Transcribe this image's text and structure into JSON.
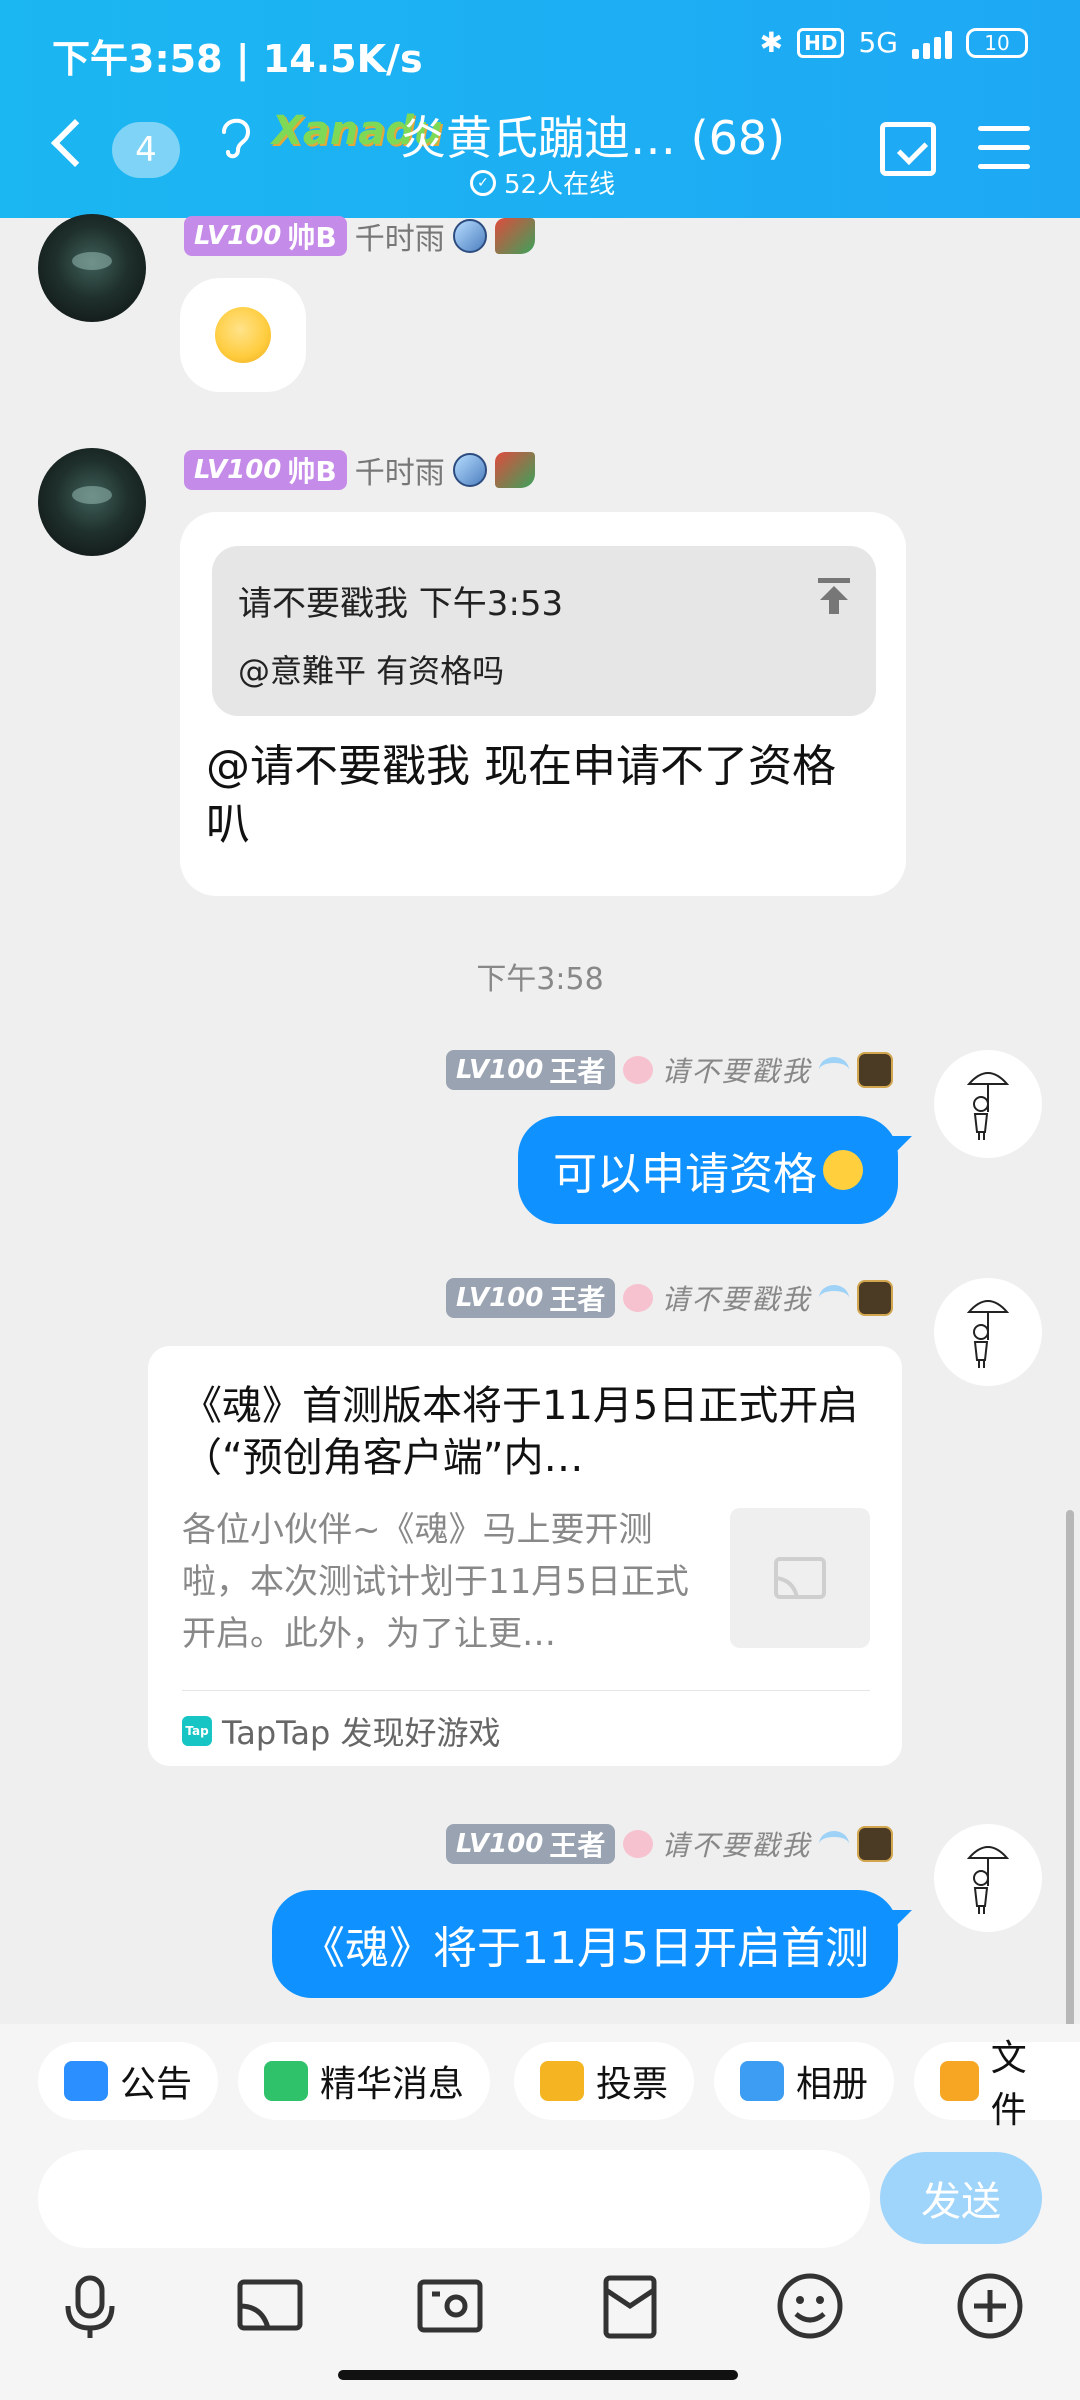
{
  "status_bar": {
    "time_speed": "下午3:58 | 14.5K/s",
    "network": "5G",
    "hd": "HD",
    "battery": "10"
  },
  "header": {
    "unread": "4",
    "group_logo": "Xanadu",
    "title": "炎黄氏蹦迪… (68)",
    "online": "52人在线"
  },
  "messages": [
    {
      "level": "LV100",
      "title": "帅B",
      "name": "千时雨"
    },
    {
      "level": "LV100",
      "title": "帅B",
      "name": "千时雨",
      "quote_line1": "请不要戳我 下午3:53",
      "quote_line2": "@意難平 有资格吗",
      "text": "@请不要戳我 现在申请不了资格叭"
    }
  ],
  "timestamp": "下午3:58",
  "self": {
    "level": "LV100",
    "title": "王者",
    "name": "请不要戳我"
  },
  "self_msg1": "可以申请资格",
  "card": {
    "title": "《魂》首测版本将于11月5日正式开启（“预创角客户端”内…",
    "desc": "各位小伙伴~《魂》马上要开测啦，本次测试计划于11月5日正式开启。此外，为了让更…",
    "source": "TapTap 发现好游戏",
    "logo": "Tap"
  },
  "self_msg2": "《魂》将于11月5日开启首测",
  "shortcuts": [
    "公告",
    "精华消息",
    "投票",
    "相册",
    "文件"
  ],
  "send_label": "发送",
  "colors": {
    "header": "#1bb7f2",
    "bubble": "#0f92ff"
  }
}
